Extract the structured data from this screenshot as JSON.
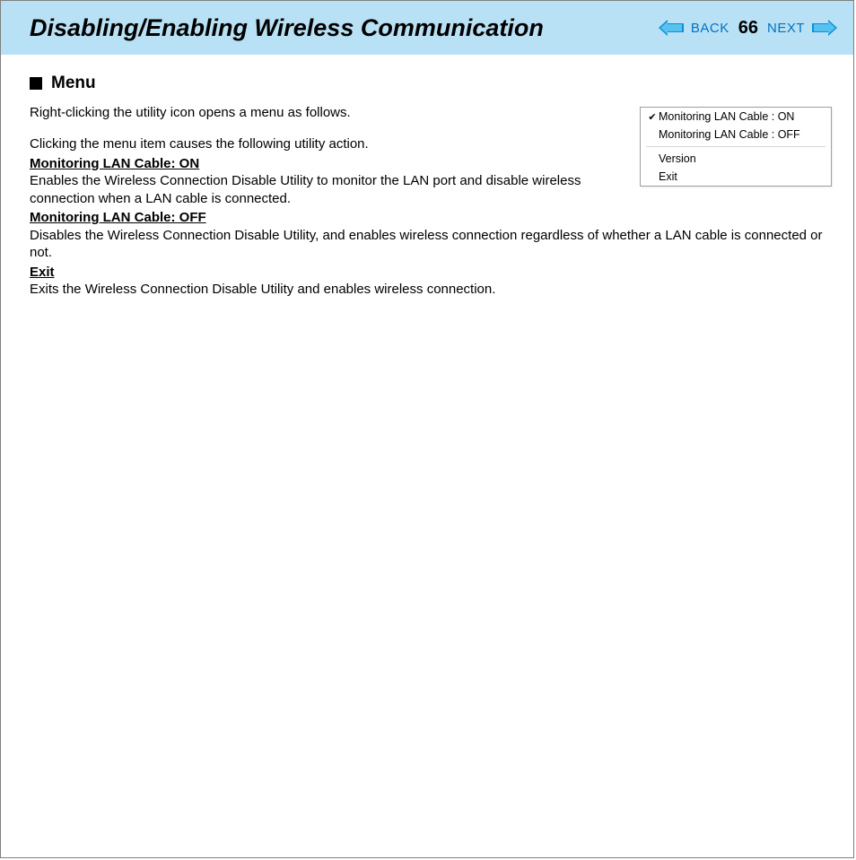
{
  "header": {
    "title": "Disabling/Enabling Wireless Communication",
    "back_label": "BACK",
    "page_number": "66",
    "next_label": "NEXT"
  },
  "section": {
    "heading": "Menu",
    "intro1": "Right-clicking the utility icon opens a menu as follows.",
    "intro2": "Clicking the menu item causes the following utility action.",
    "item1_head": "Monitoring LAN Cable: ON",
    "item1_body": "Enables the Wireless Connection Disable Utility to monitor the LAN port and disable wireless connection when a LAN cable is connected.",
    "item2_head": "Monitoring LAN Cable: OFF",
    "item2_body": "Disables the Wireless Connection Disable Utility, and enables wireless connection regardless of whether a LAN cable is connected or not.",
    "item3_head": "Exit",
    "item3_body": "Exits the Wireless Connection Disable Utility and enables wireless connection."
  },
  "menu_popup": {
    "item1": "Monitoring LAN Cable : ON",
    "item2": "Monitoring LAN Cable : OFF",
    "item3": "Version",
    "item4": "Exit"
  }
}
